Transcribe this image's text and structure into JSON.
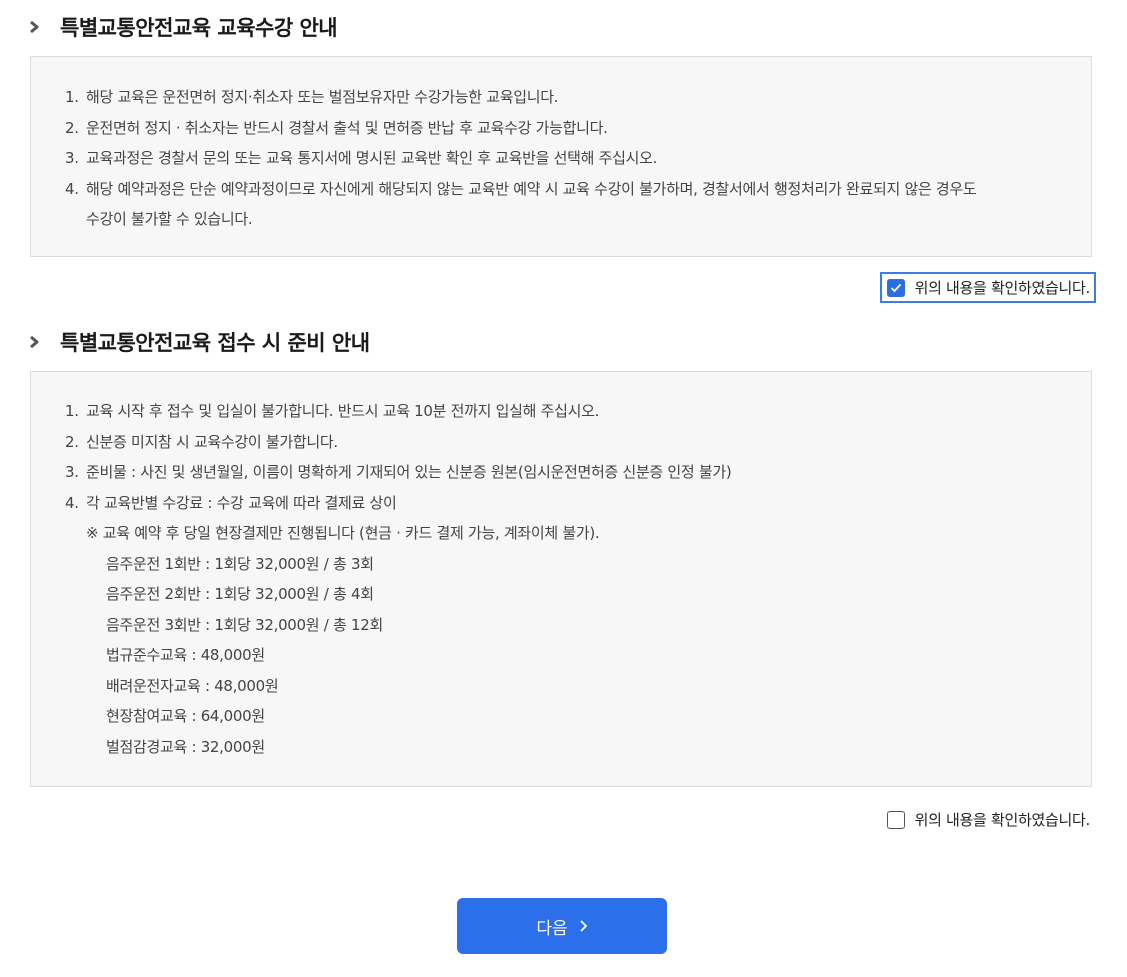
{
  "section1": {
    "title": "특별교통안전교육 교육수강 안내",
    "items": [
      {
        "num": "1.",
        "text": "해당 교육은 운전면허 정지·취소자 또는 벌점보유자만 수강가능한 교육입니다."
      },
      {
        "num": "2.",
        "text": "운전면허 정지 · 취소자는 반드시 경찰서 출석 및 면허증 반납 후 교육수강 가능합니다."
      },
      {
        "num": "3.",
        "text": "교육과정은 경찰서 문의 또는 교육 통지서에 명시된 교육반 확인 후 교육반을 선택해 주십시오."
      },
      {
        "num": "4.",
        "text": "해당 예약과정은 단순 예약과정이므로 자신에게 해당되지 않는 교육반 예약 시 교육 수강이 불가하며, 경찰서에서 행정처리가 완료되지 않은 경우도",
        "cont": "수강이 불가할 수 있습니다."
      }
    ],
    "confirm_label": "위의 내용을 확인하였습니다.",
    "confirm_checked": true
  },
  "section2": {
    "title": "특별교통안전교육 접수 시 준비 안내",
    "items": [
      {
        "num": "1.",
        "text": "교육 시작 후 접수 및 입실이 불가합니다. 반드시 교육 10분 전까지 입실해 주십시오."
      },
      {
        "num": "2.",
        "text": "신분증 미지참 시 교육수강이 불가합니다."
      },
      {
        "num": "3.",
        "text": "준비물 : 사진 및 생년월일, 이름이 명확하게 기재되어 있는 신분증 원본(임시운전면허증 신분증 인정 불가)"
      },
      {
        "num": "4.",
        "text": "각 교육반별 수강료 : 수강 교육에 따라 결제료 상이"
      }
    ],
    "note": "※ 교육 예약 후 당일 현장결제만 진행됩니다 (현금 · 카드 결제 가능, 계좌이체 불가).",
    "fees": [
      "음주운전 1회반 : 1회당 32,000원 / 총 3회",
      "음주운전 2회반 : 1회당 32,000원 / 총 4회",
      "음주운전 3회반 : 1회당 32,000원 / 총 12회",
      "법규준수교육 : 48,000원",
      "배려운전자교육 : 48,000원",
      "현장참여교육 : 64,000원",
      "벌점감경교육 : 32,000원"
    ],
    "confirm_label": "위의 내용을 확인하였습니다.",
    "confirm_checked": false
  },
  "next_button": {
    "label": "다음"
  },
  "colors": {
    "accent": "#2b6fea",
    "box_bg": "#f7f7f7",
    "box_border": "#dcdcdc"
  },
  "icons": {
    "bullet": "chevron-bullet-icon",
    "check": "check-icon",
    "next": "chevron-right-icon"
  }
}
